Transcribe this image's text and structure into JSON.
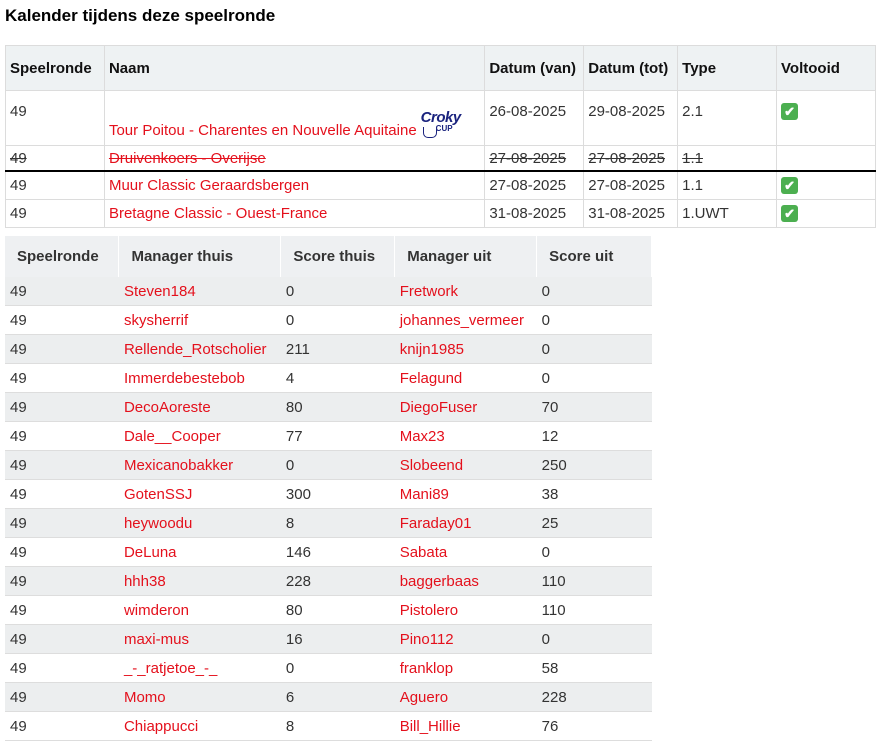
{
  "title": "Kalender tijdens deze speelronde",
  "calendar": {
    "headers": [
      "Speelronde",
      "Naam",
      "Datum (van)",
      "Datum (tot)",
      "Type",
      "Voltooid"
    ],
    "rows": [
      {
        "round": "49",
        "name": "Tour Poitou - Charentes en Nouvelle Aquitaine",
        "from": "26-08-2025",
        "to": "29-08-2025",
        "type": "2.1",
        "done": "✔",
        "logo": "croky-cup-logo",
        "struck": false
      },
      {
        "round": "49",
        "name": "Druivenkoers - Overijse",
        "from": "27-08-2025",
        "to": "27-08-2025",
        "type": "1.1",
        "done": "",
        "struck": true
      },
      {
        "round": "49",
        "name": "Muur Classic Geraardsbergen",
        "from": "27-08-2025",
        "to": "27-08-2025",
        "type": "1.1",
        "done": "✔",
        "struck": false
      },
      {
        "round": "49",
        "name": "Bretagne Classic - Ouest-France",
        "from": "31-08-2025",
        "to": "31-08-2025",
        "type": "1.UWT",
        "done": "✔",
        "struck": false
      }
    ],
    "logo_text": {
      "main": "Croky",
      "sub": "CUP"
    }
  },
  "matches": {
    "headers": [
      "Speelronde",
      "Manager thuis",
      "Score thuis",
      "Manager uit",
      "Score uit"
    ],
    "rows": [
      [
        "49",
        "Steven184",
        "0",
        "Fretwork",
        "0"
      ],
      [
        "49",
        "skysherrif",
        "0",
        "johannes_vermeer",
        "0"
      ],
      [
        "49",
        "Rellende_Rotscholier",
        "211",
        "knijn1985",
        "0"
      ],
      [
        "49",
        "Immerdebestebob",
        "4",
        "Felagund",
        "0"
      ],
      [
        "49",
        "DecoAoreste",
        "80",
        "DiegoFuser",
        "70"
      ],
      [
        "49",
        "Dale__Cooper",
        "77",
        "Max23",
        "12"
      ],
      [
        "49",
        "Mexicanobakker",
        "0",
        "Slobeend",
        "250"
      ],
      [
        "49",
        "GotenSSJ",
        "300",
        "Mani89",
        "38"
      ],
      [
        "49",
        "heywoodu",
        "8",
        "Faraday01",
        "25"
      ],
      [
        "49",
        "DeLuna",
        "146",
        "Sabata",
        "0"
      ],
      [
        "49",
        "hhh38",
        "228",
        "baggerbaas",
        "110"
      ],
      [
        "49",
        "wimderon",
        "80",
        "Pistolero",
        "110"
      ],
      [
        "49",
        "maxi-mus",
        "16",
        "Pino112",
        "0"
      ],
      [
        "49",
        "_-_ratjetoe_-_",
        "0",
        "franklop",
        "58"
      ],
      [
        "49",
        "Momo",
        "6",
        "Aguero",
        "228"
      ],
      [
        "49",
        "Chiappucci",
        "8",
        "Bill_Hillie",
        "76"
      ]
    ]
  },
  "colors": {
    "link": "#e4101c",
    "check": "#4caf50"
  }
}
